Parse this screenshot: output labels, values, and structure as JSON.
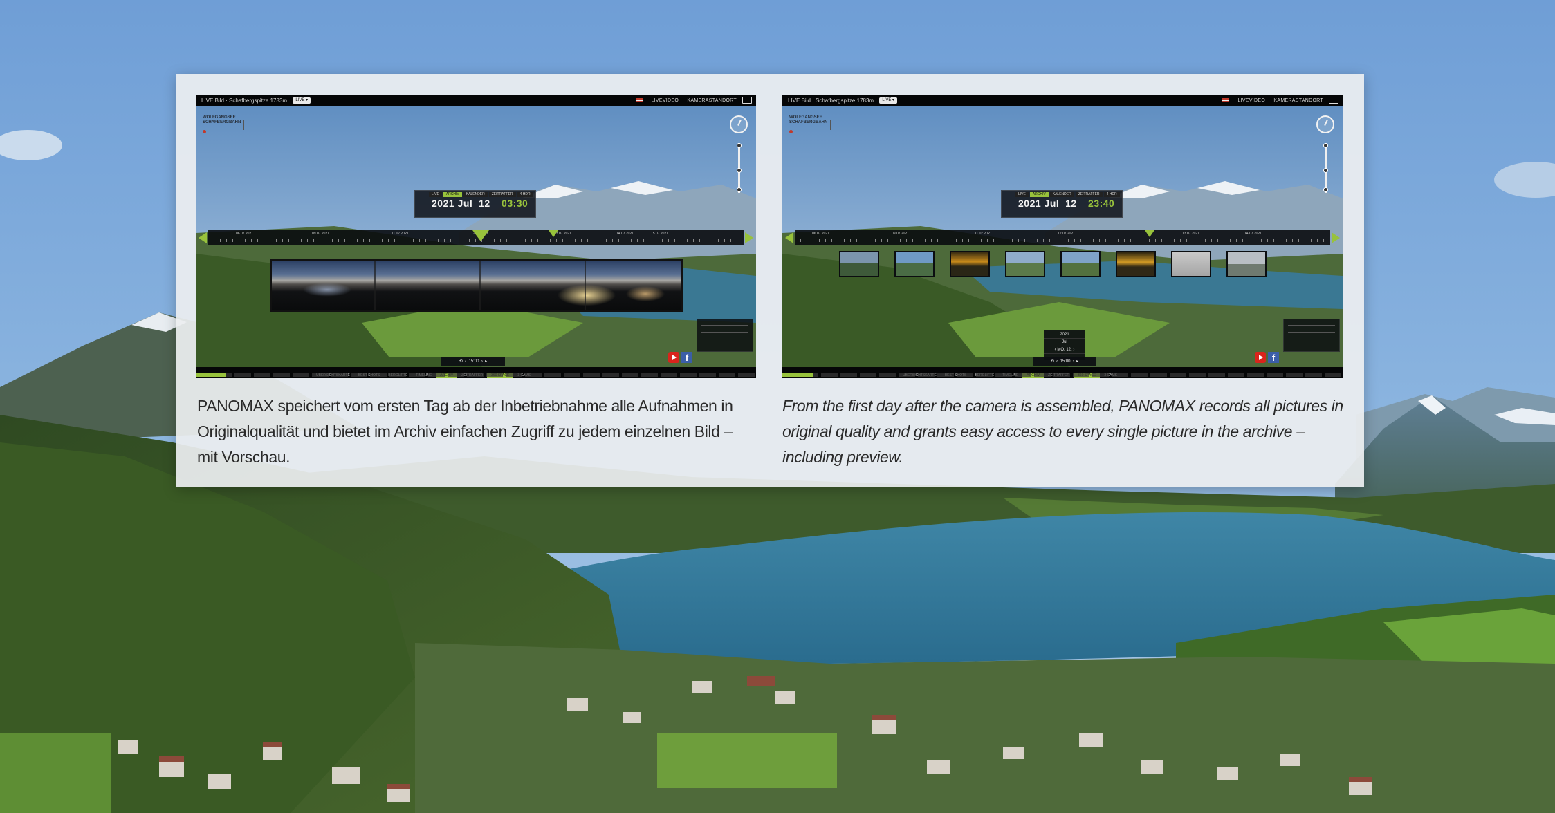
{
  "captions": {
    "german": "PANOMAX speichert vom ersten Tag ab der Inbetriebnahme alle Aufnahmen in Originalqualität und bietet im Archiv einfachen Zugriff zu jedem einzelnen Bild – mit Vorschau.",
    "english": "From the first day after the camera is assembled, PANOMAX records all pictures in original quality and grants easy access to every single picture in the archive – including preview."
  },
  "screenshot_left": {
    "date": {
      "year": "2021",
      "month": "Jul",
      "day": "12",
      "time": "03:30"
    }
  },
  "screenshot_right": {
    "date": {
      "year": "2021",
      "month": "Jul",
      "day": "12",
      "time": "23:40"
    }
  },
  "colors": {
    "accent": "#98c23c",
    "card_background": "#eceef0",
    "caption_text": "#2a2a2a"
  },
  "icons": [
    "compass-icon",
    "fullscreen-icon",
    "youtube-icon",
    "facebook-icon",
    "timeline-prev-arrow-icon",
    "timeline-next-arrow-icon"
  ]
}
